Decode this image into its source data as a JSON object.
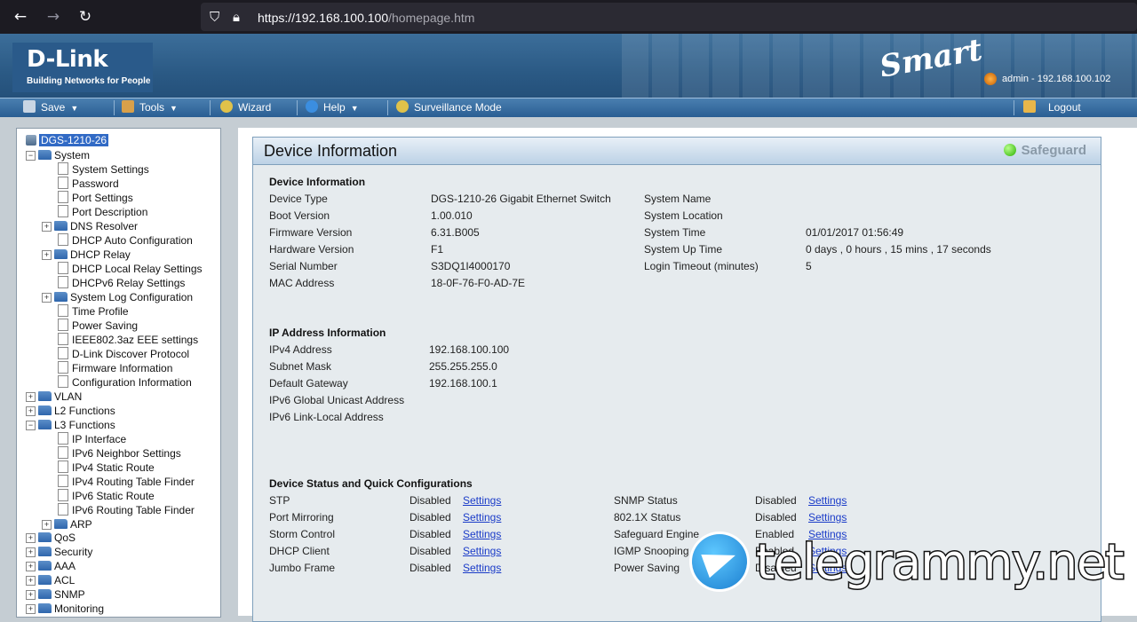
{
  "browser": {
    "url_host": "https://192.168.100.100",
    "url_path": "/homepage.htm",
    "icons": [
      "back-arrow-icon",
      "forward-arrow-icon",
      "reload-icon",
      "shield-icon",
      "lock-icon"
    ]
  },
  "header": {
    "logo": "D-Link",
    "logo_tagline": "Building Networks for People",
    "brand_script": "Smart",
    "user_info": "admin - 192.168.100.102"
  },
  "toolbar": {
    "save": "Save",
    "tools": "Tools",
    "wizard": "Wizard",
    "help": "Help",
    "surveillance": "Surveillance Mode",
    "logout": "Logout"
  },
  "tree": {
    "root": "DGS-1210-26",
    "system": "System",
    "system_items": [
      "System Settings",
      "Password",
      "Port Settings",
      "Port Description",
      "DNS Resolver",
      "DHCP Auto Configuration",
      "DHCP Relay",
      "DHCP Local Relay Settings",
      "DHCPv6 Relay Settings",
      "System Log Configuration",
      "Time Profile",
      "Power Saving",
      "IEEE802.3az EEE settings",
      "D-Link Discover Protocol",
      "Firmware Information",
      "Configuration Information"
    ],
    "vlan": "VLAN",
    "l2": "L2 Functions",
    "l3": "L3 Functions",
    "l3_items": [
      "IP Interface",
      "IPv6 Neighbor Settings",
      "IPv4 Static Route",
      "IPv4 Routing Table Finder",
      "IPv6 Static Route",
      "IPv6 Routing Table Finder",
      "ARP"
    ],
    "rest": [
      "QoS",
      "Security",
      "AAA",
      "ACL",
      "SNMP",
      "Monitoring"
    ]
  },
  "panel": {
    "title": "Device Information",
    "safeguard": "Safeguard",
    "device_info_title": "Device Information",
    "device_left": [
      {
        "label": "Device Type",
        "value": "DGS-1210-26 Gigabit Ethernet Switch"
      },
      {
        "label": "Boot Version",
        "value": "1.00.010"
      },
      {
        "label": "Firmware Version",
        "value": "6.31.B005"
      },
      {
        "label": "Hardware Version",
        "value": "F1"
      },
      {
        "label": "Serial Number",
        "value": "S3DQ1I4000170"
      },
      {
        "label": "MAC Address",
        "value": "18-0F-76-F0-AD-7E"
      }
    ],
    "device_right": [
      {
        "label": "System Name",
        "value": ""
      },
      {
        "label": "System Location",
        "value": ""
      },
      {
        "label": "System Time",
        "value": "01/01/2017 01:56:49"
      },
      {
        "label": "System Up Time",
        "value": "0 days , 0 hours , 15 mins , 17 seconds"
      },
      {
        "label": "Login Timeout (minutes)",
        "value": "5"
      }
    ],
    "ip_title": "IP Address Information",
    "ip": [
      {
        "label": "IPv4 Address",
        "value": "192.168.100.100"
      },
      {
        "label": "Subnet Mask",
        "value": "255.255.255.0"
      },
      {
        "label": "Default Gateway",
        "value": "192.168.100.1"
      },
      {
        "label": "IPv6 Global Unicast Address",
        "value": ""
      },
      {
        "label": "IPv6 Link-Local Address",
        "value": ""
      }
    ],
    "status_title": "Device Status and Quick Configurations",
    "link_text": "Settings",
    "status_left": [
      {
        "label": "STP",
        "value": "Disabled"
      },
      {
        "label": "Port Mirroring",
        "value": "Disabled"
      },
      {
        "label": "Storm Control",
        "value": "Disabled"
      },
      {
        "label": "DHCP Client",
        "value": "Disabled"
      },
      {
        "label": "Jumbo Frame",
        "value": "Disabled"
      }
    ],
    "status_right": [
      {
        "label": "SNMP Status",
        "value": "Disabled"
      },
      {
        "label": "802.1X Status",
        "value": "Disabled"
      },
      {
        "label": "Safeguard Engine",
        "value": "Enabled"
      },
      {
        "label": "IGMP Snooping",
        "value": "Enabled"
      },
      {
        "label": "Power Saving",
        "value": "Disabled"
      }
    ]
  },
  "watermark": "telegrammy.net"
}
